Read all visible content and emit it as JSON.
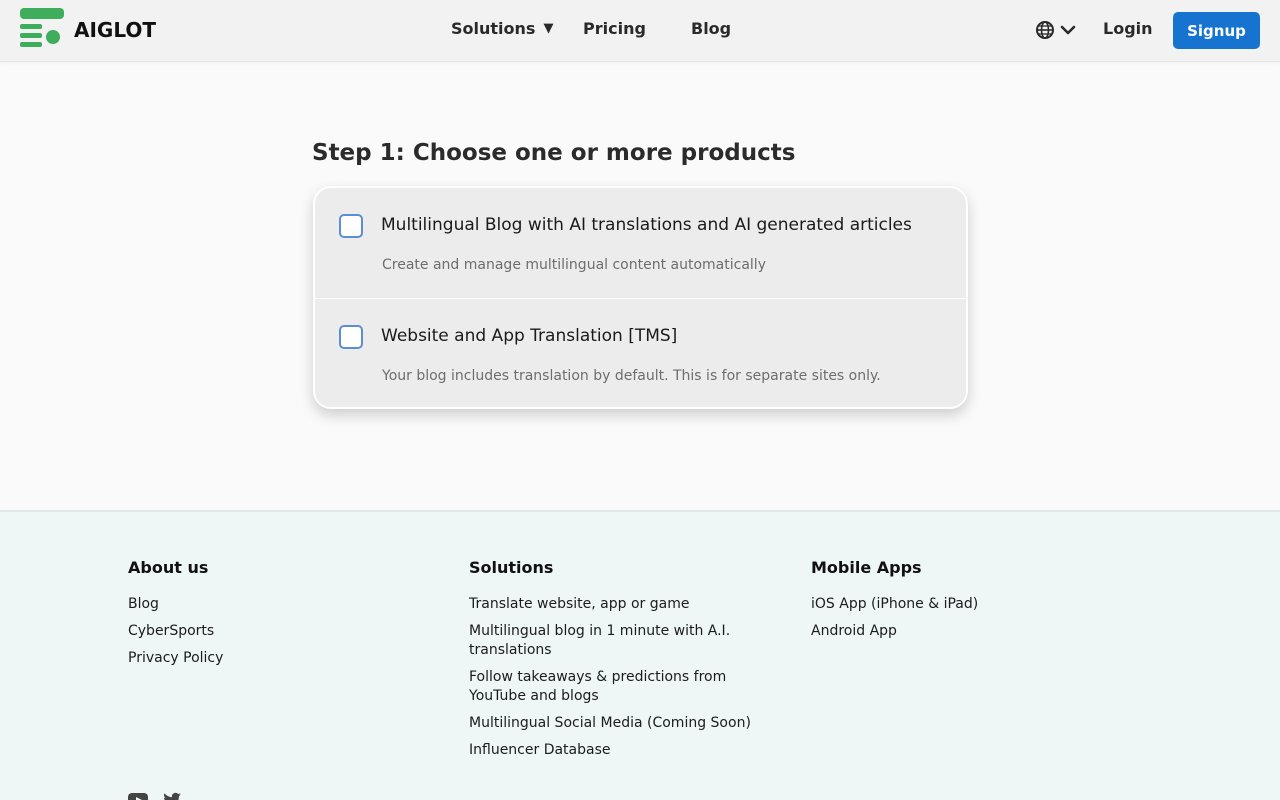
{
  "header": {
    "brand": "AIGLOT",
    "nav": {
      "solutions": "Solutions",
      "pricing": "Pricing",
      "blog": "Blog"
    },
    "login": "Login",
    "signup": "Signup"
  },
  "main": {
    "step_title": "Step 1: Choose one or more products",
    "products": [
      {
        "title": "Multilingual Blog with AI translations and AI generated articles",
        "description": "Create and manage multilingual content automatically",
        "checked": false
      },
      {
        "title": "Website and App Translation [TMS]",
        "description": "Your blog includes translation by default. This is for separate sites only.",
        "checked": false
      }
    ]
  },
  "footer": {
    "about": {
      "heading": "About us",
      "links": [
        "Blog",
        "CyberSports",
        "Privacy Policy"
      ]
    },
    "solutions": {
      "heading": "Solutions",
      "links": [
        "Translate website, app or game",
        "Multilingual blog in 1 minute with A.I. translations",
        "Follow takeaways & predictions from YouTube and blogs",
        "Multilingual Social Media (Coming Soon)",
        "Influencer Database"
      ]
    },
    "mobile": {
      "heading": "Mobile Apps",
      "links": [
        "iOS App (iPhone & iPad)",
        "Android App"
      ]
    }
  },
  "colors": {
    "accent": "#1673d0",
    "brand_green": "#3fae5c",
    "checkbox_border": "#5b8fd1"
  },
  "icons": [
    "logo-icon",
    "caret-down-icon",
    "globe-icon",
    "chevron-down-icon",
    "youtube-icon",
    "twitter-icon"
  ]
}
